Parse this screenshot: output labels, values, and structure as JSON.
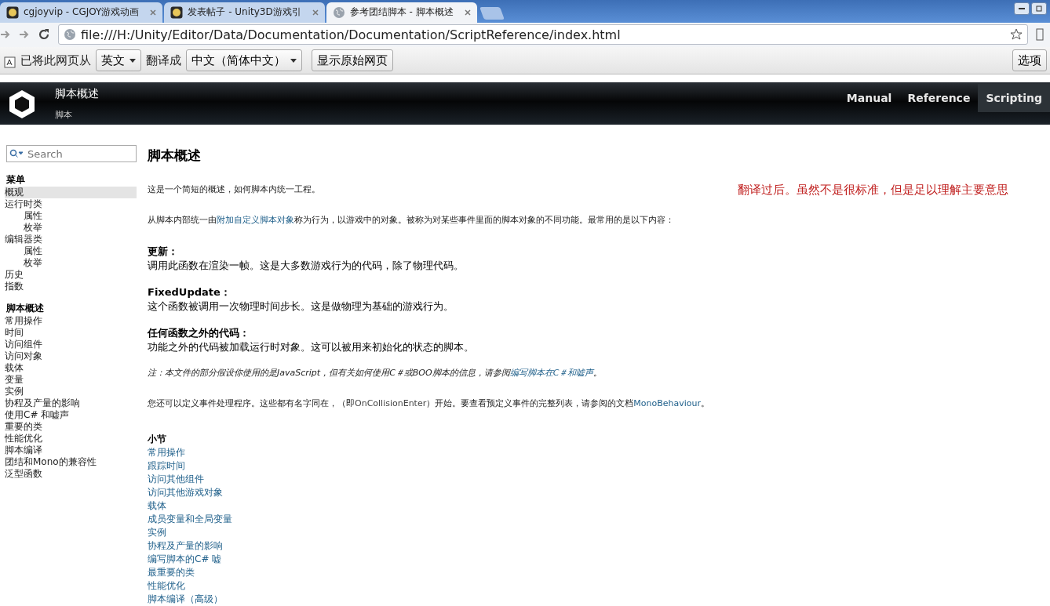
{
  "browser": {
    "tabs": [
      {
        "title": "cgjoyvip - CGJOY游戏动画",
        "selected": false
      },
      {
        "title": "发表帖子 - Unity3D游戏引",
        "selected": false
      },
      {
        "title": "参考团结脚本 - 脚本概述",
        "selected": true
      }
    ],
    "address": "file:///H:/Unity/Editor/Data/Documentation/Documentation/ScriptReference/index.html"
  },
  "translate_bar": {
    "label_from": "已将此网页从",
    "from": "英文",
    "label_to": "翻译成",
    "to": "中文（简体中文）",
    "show_original": "显示原始网页",
    "options": "选项"
  },
  "header": {
    "title": "脚本概述",
    "breadcrumb": "脚本",
    "nav": [
      {
        "label": "Manual",
        "selected": false
      },
      {
        "label": "Reference",
        "selected": false
      },
      {
        "label": "Scripting",
        "selected": true
      }
    ]
  },
  "sidebar": {
    "search": {
      "placeholder": "Search"
    },
    "groups": [
      {
        "heading": "菜单",
        "items": [
          {
            "label": "概观",
            "selected": true
          },
          {
            "label": "运行时类",
            "selected": false,
            "children": [
              {
                "label": "属性",
                "selected": false
              },
              {
                "label": "枚举",
                "selected": false
              }
            ]
          },
          {
            "label": "编辑器类",
            "selected": false,
            "children": [
              {
                "label": "属性",
                "selected": false
              },
              {
                "label": "枚举",
                "selected": false
              }
            ]
          },
          {
            "label": "历史",
            "selected": false
          },
          {
            "label": "指数",
            "selected": false
          }
        ]
      },
      {
        "heading": "脚本概述",
        "items": [
          {
            "label": "常用操作",
            "selected": false
          },
          {
            "label": "时间",
            "selected": false
          },
          {
            "label": "访问组件",
            "selected": false
          },
          {
            "label": "访问对象",
            "selected": false
          },
          {
            "label": "载体",
            "selected": false
          },
          {
            "label": "变量",
            "selected": false
          },
          {
            "label": "实例",
            "selected": false
          },
          {
            "label": "协程及产量的影响",
            "selected": false
          },
          {
            "label": "使用C# 和嘘声",
            "selected": false
          },
          {
            "label": "重要的类",
            "selected": false
          },
          {
            "label": "性能优化",
            "selected": false
          },
          {
            "label": "脚本编译",
            "selected": false
          },
          {
            "label": "团结和Mono的兼容性",
            "selected": false
          },
          {
            "label": "泛型函数",
            "selected": false
          }
        ]
      }
    ]
  },
  "content": {
    "title": "脚本概述",
    "blocks": [
      {
        "kind": "para",
        "parts": [
          {
            "kind": "text",
            "text": "这是一个简短的概述，如何脚本内统一工程。"
          }
        ]
      },
      {
        "kind": "para",
        "parts": [
          {
            "kind": "text",
            "text": "从脚本内部统一由"
          },
          {
            "kind": "link",
            "text": "附加自定义脚本对象"
          },
          {
            "kind": "text",
            "text": "称为行为，以游戏中的对象。被称为对某些事件里面的脚本对象的不同功能。最常用的是以下内容："
          }
        ]
      },
      {
        "kind": "def",
        "term": "更新：",
        "text": "调用此函数在渲染一帧。这是大多数游戏行为的代码，除了物理代码。"
      },
      {
        "kind": "def",
        "term": "FixedUpdate：",
        "text": "这个函数被调用一次物理时间步长。这是做物理为基础的游戏行为。"
      },
      {
        "kind": "def",
        "term": "任何函数之外的代码：",
        "text": "功能之外的代码被加载运行时对象。这可以被用来初始化的状态的脚本。"
      },
      {
        "kind": "note",
        "parts": [
          {
            "kind": "text",
            "text": "注：本文件的部分假设你使用的是JavaScript，但有关如何使用C＃或BOO脚本的信息，请参阅"
          },
          {
            "kind": "link",
            "text": "编写脚本在C＃和嘘声"
          },
          {
            "kind": "text",
            "text": "。"
          }
        ]
      },
      {
        "kind": "para",
        "parts": [
          {
            "kind": "text",
            "text": "您还可以定义事件处理程序。这些都有名字同在，（即"
          },
          {
            "kind": "code",
            "text": "OnCollisionEnter"
          },
          {
            "kind": "text",
            "text": "）开始。要查看预定义事件的完整列表，请参阅的文档"
          },
          {
            "kind": "link",
            "text": "MonoBehaviour"
          },
          {
            "kind": "text",
            "text": "。"
          }
        ]
      }
    ],
    "subsections": {
      "heading": "小节",
      "links": [
        "常用操作",
        "跟踪时间",
        "访问其他组件",
        "访问其他游戏对象",
        "载体",
        "成员变量和全局变量",
        "实例",
        "协程及产量的影响",
        "编写脚本的C# 嘘",
        "最重要的类",
        "性能优化",
        "脚本编译（高级）"
      ]
    }
  },
  "annotation": "翻译过后。虽然不是很标准，但是足以理解主要意思"
}
